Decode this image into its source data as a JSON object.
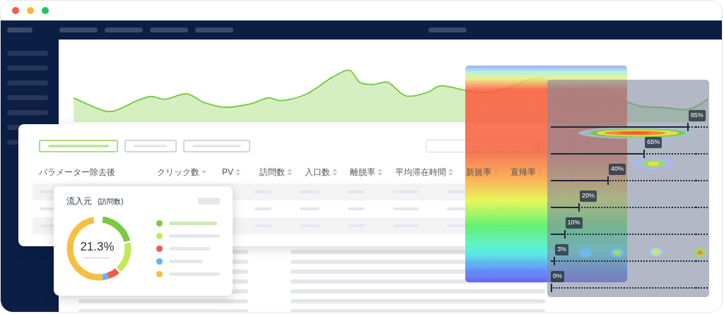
{
  "window": {
    "controls": [
      {
        "color": "#f25a51"
      },
      {
        "color": "#f4bb3a"
      },
      {
        "color": "#24c55e"
      }
    ]
  },
  "table": {
    "tabs": [
      {
        "selected": true
      },
      {
        "selected": false
      },
      {
        "selected": false
      }
    ],
    "columns": [
      {
        "label": "パラメーター除去後",
        "kind": "plain"
      },
      {
        "label": "クリック数",
        "kind": "down"
      },
      {
        "label": "PV",
        "kind": "updown"
      },
      {
        "label": "訪問数",
        "kind": "updown"
      },
      {
        "label": "入口数",
        "kind": "updown"
      },
      {
        "label": "離脱率",
        "kind": "updown"
      },
      {
        "label": "平均滞在時間",
        "kind": "updown"
      },
      {
        "label": "新規率",
        "kind": "updown"
      },
      {
        "label": "直帰率",
        "kind": "updown"
      }
    ]
  },
  "source_card": {
    "title": "流入元",
    "subtitle": "(訪問数)",
    "value": "21.3%",
    "legend": [
      {
        "color": "#7ac943",
        "selected": true
      },
      {
        "color": "#c4e85a",
        "selected": false
      },
      {
        "color": "#f25a4a",
        "selected": false
      },
      {
        "color": "#5bb8f5",
        "selected": false
      },
      {
        "color": "#f6bf3f",
        "selected": false
      }
    ]
  },
  "scroll_depth": {
    "markers": [
      {
        "label": "95%",
        "level": 0.95
      },
      {
        "label": "65%",
        "level": 0.65
      },
      {
        "label": "40%",
        "level": 0.4
      },
      {
        "label": "20%",
        "level": 0.2
      },
      {
        "label": "10%",
        "level": 0.1
      },
      {
        "label": "3%",
        "level": 0.03
      },
      {
        "label": "0%",
        "level": 0
      }
    ]
  }
}
